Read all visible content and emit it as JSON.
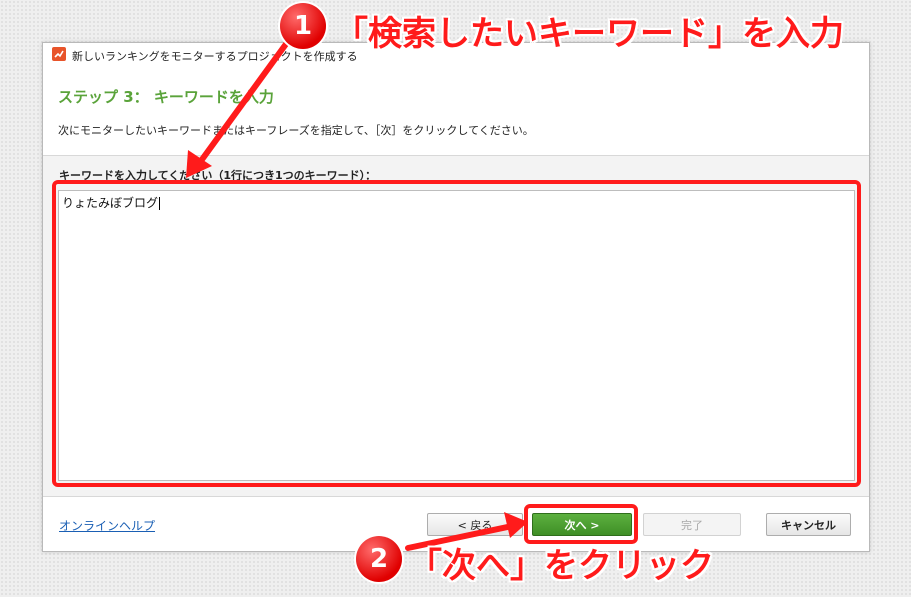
{
  "window": {
    "title": "新しいランキングをモニターするプロジェクトを作成する"
  },
  "wizard": {
    "step_title": "ステップ 3： キーワードを入力",
    "step_description": "次にモニターしたいキーワードまたはキーフレーズを指定して、［次］をクリックしてください。",
    "keyword_label": "キーワードを入力してください（1行につき1つのキーワード）：",
    "keyword_value": "りょたみぼブログ"
  },
  "footer": {
    "help_link": "オンラインヘルプ",
    "back_label": "< 戻る",
    "next_label": "次へ >",
    "finish_label": "完了",
    "cancel_label": "キャンセル"
  },
  "annotations": {
    "step1_number": "1",
    "step1_text": "「検索したいキーワード」を入力",
    "step2_number": "2",
    "step2_text": "「次へ」をクリック",
    "color": "#ff1b1b"
  },
  "colors": {
    "accent_green": "#5aa33a",
    "next_button_green": "#4a9e2f",
    "link_blue": "#1a5fb4",
    "app_icon": "#e8542a"
  }
}
